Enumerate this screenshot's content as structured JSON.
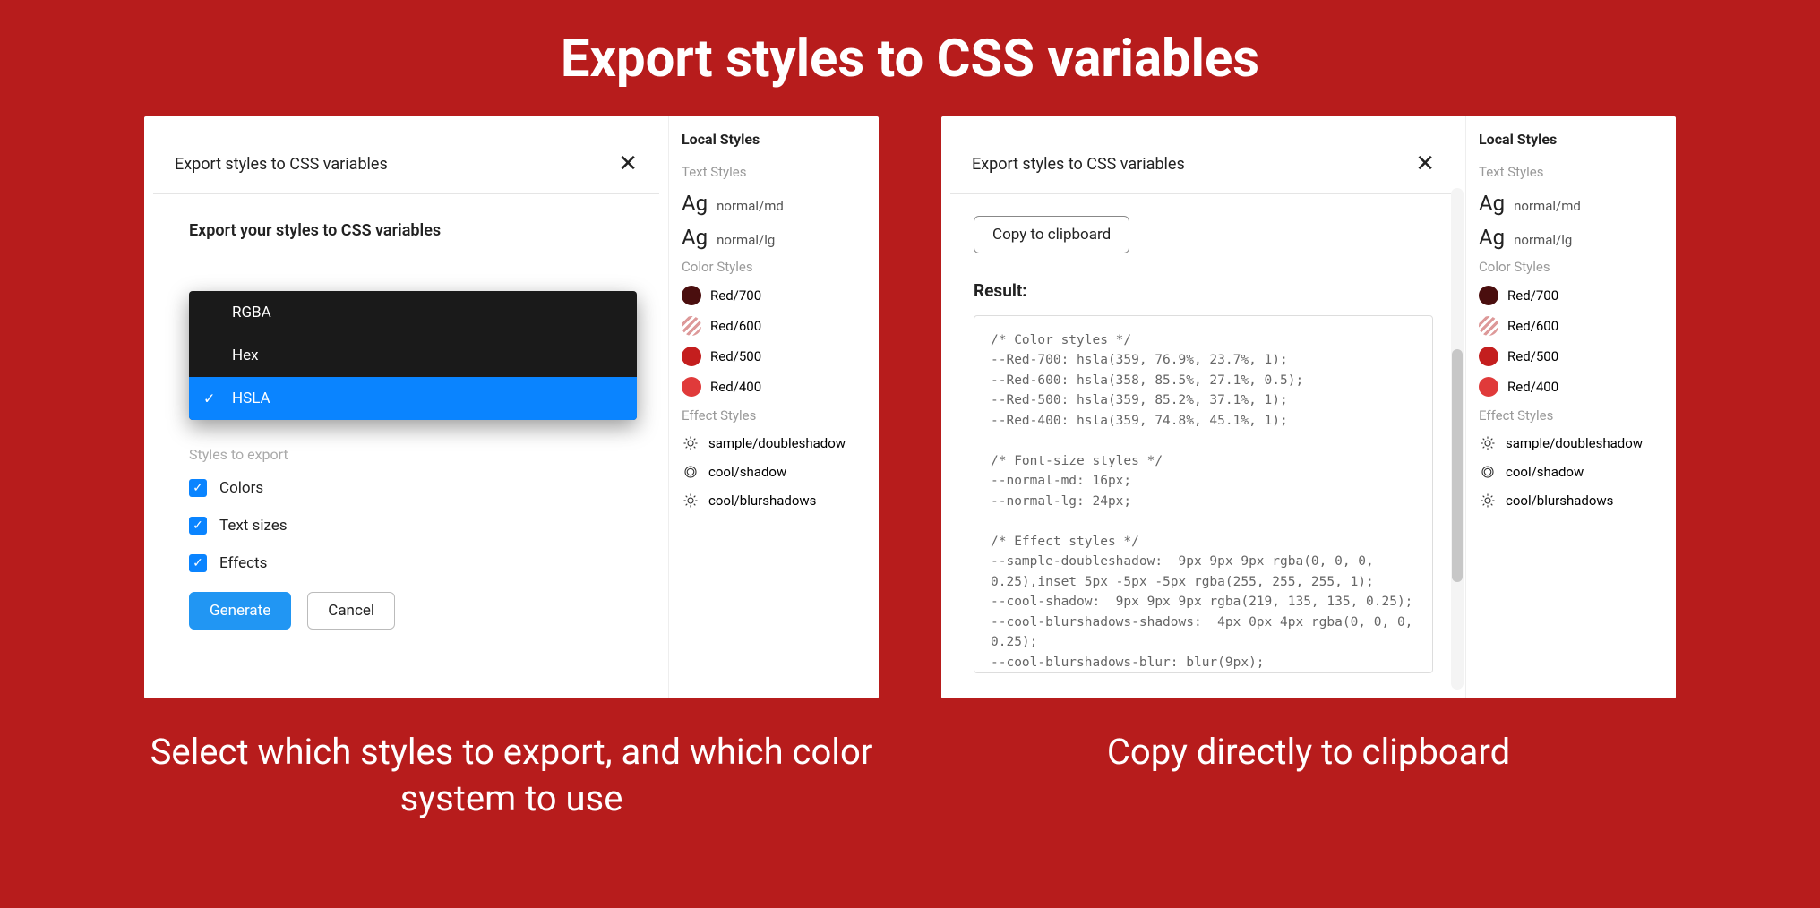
{
  "page_title": "Export styles to CSS variables",
  "panel1": {
    "modal_title": "Export styles to CSS variables",
    "body_heading": "Export your styles to CSS variables",
    "color_formats": [
      "RGBA",
      "Hex",
      "HSLA"
    ],
    "selected_format": "HSLA",
    "styles_label": "Styles to export",
    "checkboxes": [
      {
        "label": "Colors",
        "checked": true
      },
      {
        "label": "Text sizes",
        "checked": true
      },
      {
        "label": "Effects",
        "checked": true
      }
    ],
    "generate_label": "Generate",
    "cancel_label": "Cancel",
    "caption": "Select which styles to export, and which color system to use"
  },
  "panel2": {
    "modal_title": "Export styles to CSS variables",
    "copy_label": "Copy to clipboard",
    "result_label": "Result:",
    "code": "/* Color styles */\n--Red-700: hsla(359, 76.9%, 23.7%, 1);\n--Red-600: hsla(358, 85.5%, 27.1%, 0.5);\n--Red-500: hsla(359, 85.2%, 37.1%, 1);\n--Red-400: hsla(359, 74.8%, 45.1%, 1);\n\n/* Font-size styles */\n--normal-md: 16px;\n--normal-lg: 24px;\n\n/* Effect styles */\n--sample-doubleshadow:  9px 9px 9px rgba(0, 0, 0, 0.25),inset 5px -5px -5px rgba(255, 255, 255, 1);\n--cool-shadow:  9px 9px 9px rgba(219, 135, 135, 0.25);\n--cool-blurshadows-shadows:  4px 0px 4px rgba(0, 0, 0, 0.25);\n--cool-blurshadows-blur: blur(9px);",
    "caption": "Copy directly to clipboard"
  },
  "local_styles": {
    "title": "Local Styles",
    "sections": {
      "text": "Text Styles",
      "color": "Color Styles",
      "effect": "Effect Styles"
    },
    "text_styles": [
      {
        "sample": "Ag",
        "name": "normal/md"
      },
      {
        "sample": "Ag",
        "name": "normal/lg"
      }
    ],
    "color_styles": [
      {
        "name": "Red/700",
        "color": "#4a0e0e"
      },
      {
        "name": "Red/600",
        "color": "#d98a8a",
        "striped": true
      },
      {
        "name": "Red/500",
        "color": "#c41e1e"
      },
      {
        "name": "Red/400",
        "color": "#e03a3a"
      }
    ],
    "effect_styles": [
      {
        "name": "sample/doubleshadow",
        "icon": "sun"
      },
      {
        "name": "cool/shadow",
        "icon": "ring"
      },
      {
        "name": "cool/blurshadows",
        "icon": "sun"
      }
    ]
  }
}
